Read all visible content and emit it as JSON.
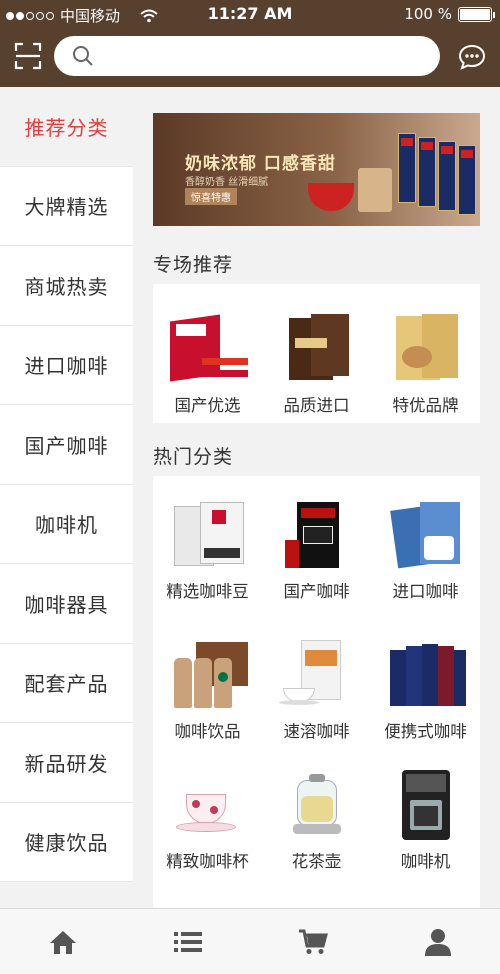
{
  "status_bar": {
    "carrier": "中国移动",
    "time": "11:27 AM",
    "battery": "100 %",
    "battery_level": 1.0,
    "signal_bars_filled": 2,
    "signal_bars_total": 5
  },
  "header": {
    "search_placeholder": "",
    "scan_icon": "scan-icon",
    "chat_icon": "chat-bubble-icon"
  },
  "sidebar": {
    "items": [
      {
        "label": "推荐分类",
        "active": true
      },
      {
        "label": "大牌精选",
        "active": false
      },
      {
        "label": "商城热卖",
        "active": false
      },
      {
        "label": "进口咖啡",
        "active": false
      },
      {
        "label": "国产咖啡",
        "active": false
      },
      {
        "label": "咖啡机",
        "active": false
      },
      {
        "label": "咖啡器具",
        "active": false
      },
      {
        "label": "配套产品",
        "active": false
      },
      {
        "label": "新品研发",
        "active": false
      },
      {
        "label": "健康饮品",
        "active": false
      }
    ]
  },
  "banner": {
    "headline": "奶味浓郁 口感香甜",
    "subline": "香醇奶香 丝滑细腻",
    "tag": "惊喜特惠"
  },
  "featured": {
    "title": "专场推荐",
    "items": [
      {
        "label": "国产优选"
      },
      {
        "label": "品质进口"
      },
      {
        "label": "特优品牌"
      }
    ]
  },
  "hot_categories": {
    "title": "热门分类",
    "items": [
      {
        "label": "精选咖啡豆"
      },
      {
        "label": "国产咖啡"
      },
      {
        "label": "进口咖啡"
      },
      {
        "label": "咖啡饮品"
      },
      {
        "label": "速溶咖啡"
      },
      {
        "label": "便携式咖啡"
      },
      {
        "label": "精致咖啡杯"
      },
      {
        "label": "花茶壶"
      },
      {
        "label": "咖啡机"
      }
    ]
  },
  "bottom_nav": [
    {
      "icon": "home-icon"
    },
    {
      "icon": "list-icon"
    },
    {
      "icon": "cart-icon"
    },
    {
      "icon": "user-icon"
    }
  ],
  "colors": {
    "header_bg": "#58402f",
    "active_text": "#e53d3d",
    "page_bg": "#f2f2f2"
  }
}
